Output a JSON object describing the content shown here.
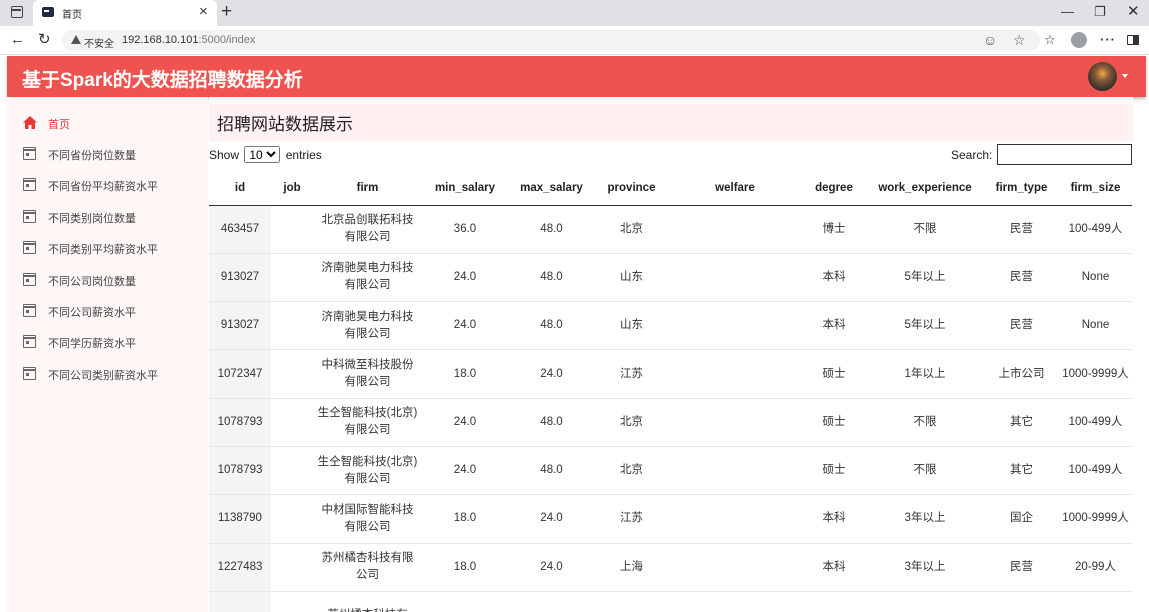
{
  "browser": {
    "tab_title": "首页",
    "insecure_label": "不安全",
    "url_host": "192.168.10.101",
    "url_rest": ":5000/index"
  },
  "app": {
    "title": "基于Spark的大数据招聘数据分析"
  },
  "sidebar": {
    "items": [
      {
        "label": "首页",
        "icon": "home-icon",
        "active": true
      },
      {
        "label": "不同省份岗位数量",
        "icon": "calendar-icon"
      },
      {
        "label": "不同省份平均薪资水平",
        "icon": "calendar-icon"
      },
      {
        "label": "不同类别岗位数量",
        "icon": "calendar-icon"
      },
      {
        "label": "不同类别平均薪资水平",
        "icon": "calendar-icon"
      },
      {
        "label": "不同公司岗位数量",
        "icon": "calendar-icon"
      },
      {
        "label": "不同公司薪资水平",
        "icon": "calendar-icon"
      },
      {
        "label": "不同学历薪资水平",
        "icon": "calendar-icon"
      },
      {
        "label": "不同公司类别薪资水平",
        "icon": "calendar-icon"
      }
    ]
  },
  "main": {
    "title": "招聘网站数据展示",
    "show_label": "Show",
    "entries_label": "entries",
    "page_length": "10",
    "search_label": "Search:",
    "search_value": ""
  },
  "table": {
    "columns": [
      "id",
      "job",
      "firm",
      "min_salary",
      "max_salary",
      "province",
      "welfare",
      "degree",
      "work_experience",
      "firm_type",
      "firm_size"
    ],
    "rows": [
      {
        "id": "463457",
        "job": "",
        "firm": "北京品创联拓科技有限公司",
        "min_salary": "36.0",
        "max_salary": "48.0",
        "province": "北京",
        "welfare": "",
        "degree": "博士",
        "work_experience": "不限",
        "firm_type": "民营",
        "firm_size": "100-499人"
      },
      {
        "id": "913027",
        "job": "",
        "firm": "济南驰昊电力科技有限公司",
        "min_salary": "24.0",
        "max_salary": "48.0",
        "province": "山东",
        "welfare": "",
        "degree": "本科",
        "work_experience": "5年以上",
        "firm_type": "民营",
        "firm_size": "None"
      },
      {
        "id": "913027",
        "job": "",
        "firm": "济南驰昊电力科技有限公司",
        "min_salary": "24.0",
        "max_salary": "48.0",
        "province": "山东",
        "welfare": "",
        "degree": "本科",
        "work_experience": "5年以上",
        "firm_type": "民营",
        "firm_size": "None"
      },
      {
        "id": "1072347",
        "job": "",
        "firm": "中科微至科技股份有限公司",
        "min_salary": "18.0",
        "max_salary": "24.0",
        "province": "江苏",
        "welfare": "",
        "degree": "硕士",
        "work_experience": "1年以上",
        "firm_type": "上市公司",
        "firm_size": "1000-9999人"
      },
      {
        "id": "1078793",
        "job": "",
        "firm": "生仝智能科技(北京)有限公司",
        "min_salary": "24.0",
        "max_salary": "48.0",
        "province": "北京",
        "welfare": "",
        "degree": "硕士",
        "work_experience": "不限",
        "firm_type": "其它",
        "firm_size": "100-499人"
      },
      {
        "id": "1078793",
        "job": "",
        "firm": "生仝智能科技(北京)有限公司",
        "min_salary": "24.0",
        "max_salary": "48.0",
        "province": "北京",
        "welfare": "",
        "degree": "硕士",
        "work_experience": "不限",
        "firm_type": "其它",
        "firm_size": "100-499人"
      },
      {
        "id": "1138790",
        "job": "",
        "firm": "中材国际智能科技有限公司",
        "min_salary": "18.0",
        "max_salary": "24.0",
        "province": "江苏",
        "welfare": "",
        "degree": "本科",
        "work_experience": "3年以上",
        "firm_type": "国企",
        "firm_size": "1000-9999人"
      },
      {
        "id": "1227483",
        "job": "",
        "firm": "苏州橘杏科技有限公司",
        "min_salary": "18.0",
        "max_salary": "24.0",
        "province": "上海",
        "welfare": "",
        "degree": "本科",
        "work_experience": "3年以上",
        "firm_type": "民营",
        "firm_size": "20-99人"
      },
      {
        "id": "",
        "job": "",
        "firm": "苏州橘杏科技有",
        "min_salary": "",
        "max_salary": "",
        "province": "",
        "welfare": "",
        "degree": "",
        "work_experience": "",
        "firm_type": "",
        "firm_size": ""
      }
    ]
  }
}
